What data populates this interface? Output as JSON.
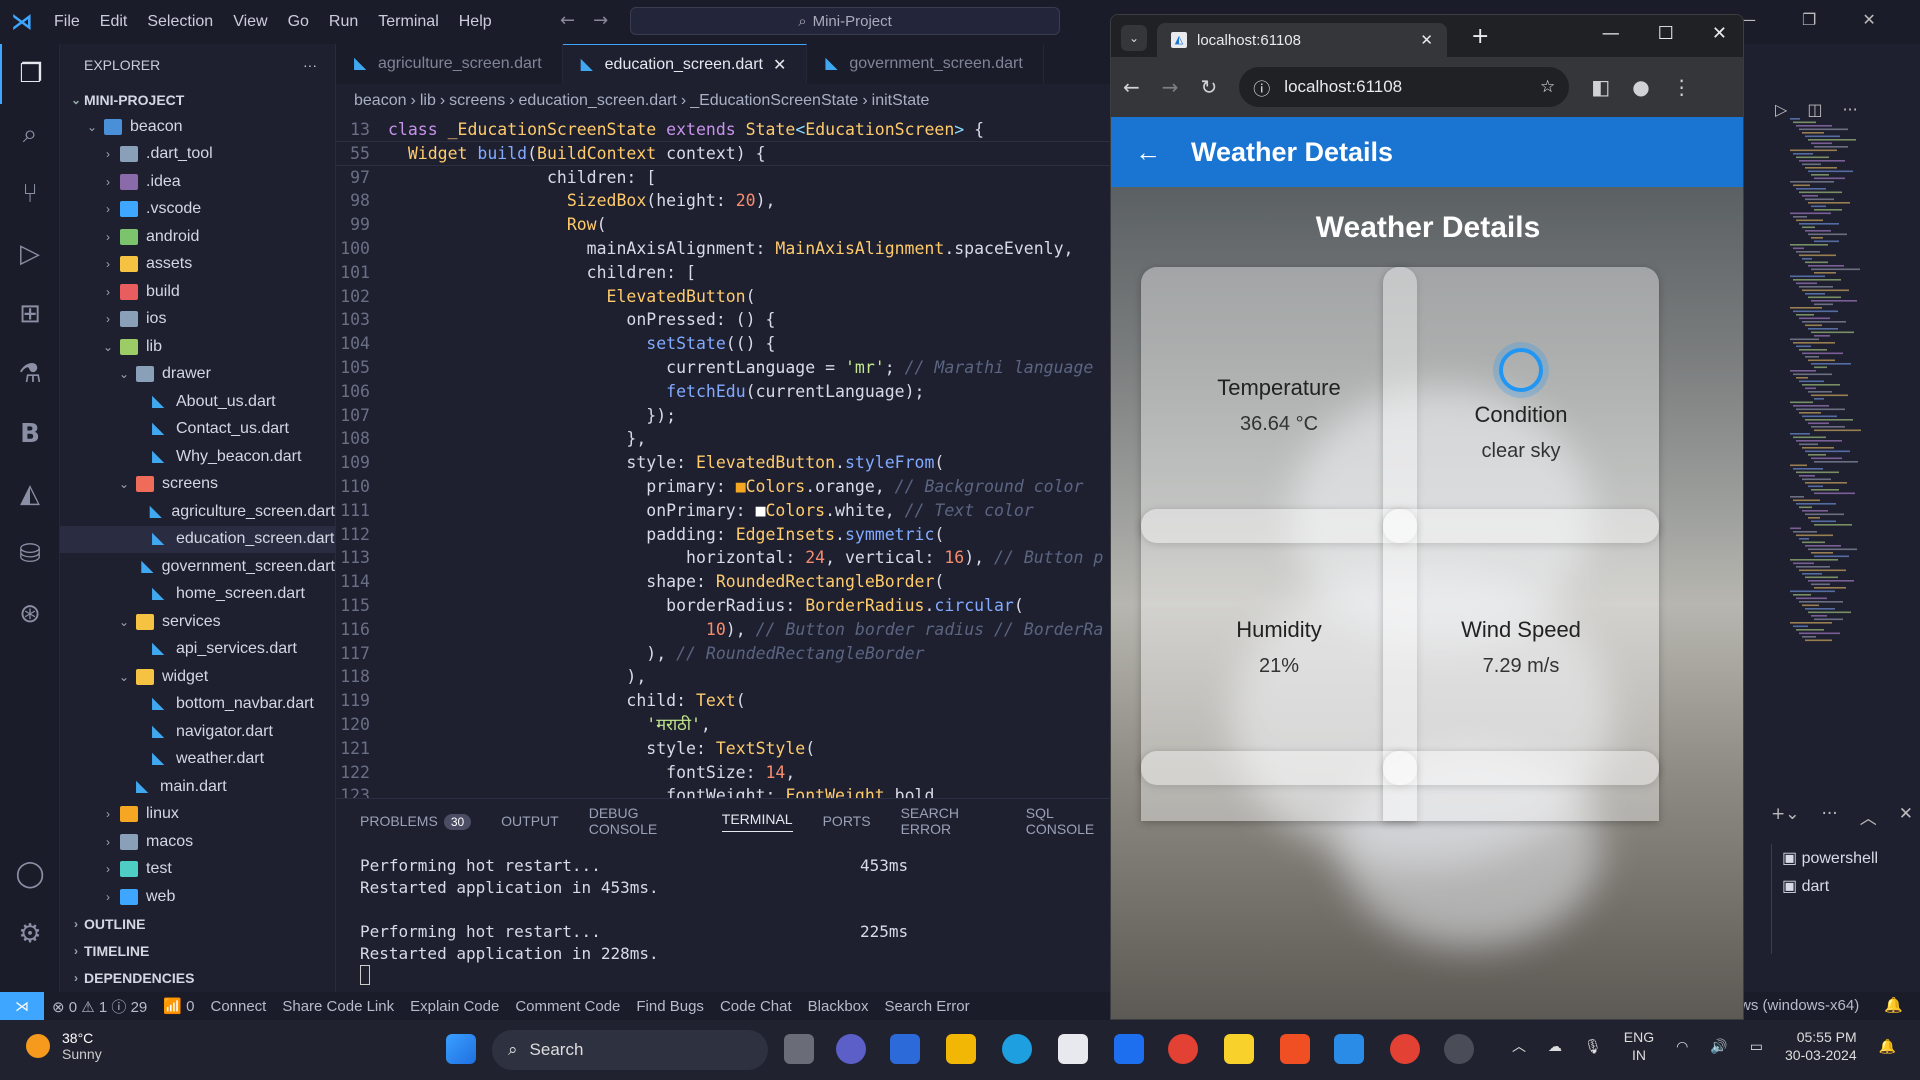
{
  "menu": [
    "File",
    "Edit",
    "Selection",
    "View",
    "Go",
    "Run",
    "Terminal",
    "Help"
  ],
  "command_center": "Mini-Project",
  "explorer": {
    "title": "EXPLORER",
    "project": "MINI-PROJECT",
    "tree": [
      {
        "label": "beacon",
        "depth": 1,
        "type": "folder-open",
        "color": "#4a90d9"
      },
      {
        "label": ".dart_tool",
        "depth": 2,
        "type": "folder",
        "color": "#8aa0b8"
      },
      {
        "label": ".idea",
        "depth": 2,
        "type": "folder",
        "color": "#8a6aa8"
      },
      {
        "label": ".vscode",
        "depth": 2,
        "type": "folder",
        "color": "#3ea6ff"
      },
      {
        "label": "android",
        "depth": 2,
        "type": "folder",
        "color": "#7cc36e"
      },
      {
        "label": "assets",
        "depth": 2,
        "type": "folder",
        "color": "#f5c242"
      },
      {
        "label": "build",
        "depth": 2,
        "type": "folder",
        "color": "#e85d5d"
      },
      {
        "label": "ios",
        "depth": 2,
        "type": "folder",
        "color": "#8aa0b8"
      },
      {
        "label": "lib",
        "depth": 2,
        "type": "folder-open",
        "color": "#9ccc65"
      },
      {
        "label": "drawer",
        "depth": 3,
        "type": "folder-open",
        "color": "#8aa0b8"
      },
      {
        "label": "About_us.dart",
        "depth": 4,
        "type": "dart"
      },
      {
        "label": "Contact_us.dart",
        "depth": 4,
        "type": "dart"
      },
      {
        "label": "Why_beacon.dart",
        "depth": 4,
        "type": "dart"
      },
      {
        "label": "screens",
        "depth": 3,
        "type": "folder-open",
        "color": "#ef6c5a"
      },
      {
        "label": "agriculture_screen.dart",
        "depth": 4,
        "type": "dart"
      },
      {
        "label": "education_screen.dart",
        "depth": 4,
        "type": "dart",
        "selected": true
      },
      {
        "label": "government_screen.dart",
        "depth": 4,
        "type": "dart"
      },
      {
        "label": "home_screen.dart",
        "depth": 4,
        "type": "dart"
      },
      {
        "label": "services",
        "depth": 3,
        "type": "folder-open",
        "color": "#f5c242"
      },
      {
        "label": "api_services.dart",
        "depth": 4,
        "type": "dart"
      },
      {
        "label": "widget",
        "depth": 3,
        "type": "folder-open",
        "color": "#f5c242"
      },
      {
        "label": "bottom_navbar.dart",
        "depth": 4,
        "type": "dart"
      },
      {
        "label": "navigator.dart",
        "depth": 4,
        "type": "dart"
      },
      {
        "label": "weather.dart",
        "depth": 4,
        "type": "dart"
      },
      {
        "label": "main.dart",
        "depth": 3,
        "type": "dart"
      },
      {
        "label": "linux",
        "depth": 2,
        "type": "folder",
        "color": "#f5a623"
      },
      {
        "label": "macos",
        "depth": 2,
        "type": "folder",
        "color": "#8aa0b8"
      },
      {
        "label": "test",
        "depth": 2,
        "type": "folder",
        "color": "#4ecdc4"
      },
      {
        "label": "web",
        "depth": 2,
        "type": "folder",
        "color": "#3ea6ff"
      }
    ],
    "sections": [
      "OUTLINE",
      "TIMELINE",
      "DEPENDENCIES"
    ]
  },
  "tabs": [
    {
      "label": "agriculture_screen.dart",
      "active": false
    },
    {
      "label": "education_screen.dart",
      "active": true
    },
    {
      "label": "government_screen.dart",
      "active": false
    }
  ],
  "breadcrumb": [
    "beacon",
    "lib",
    "screens",
    "education_screen.dart",
    "_EducationScreenState",
    "initState"
  ],
  "code": {
    "sticky": [
      {
        "n": "13",
        "html": "<span class='kw'>class</span> <span class='ty'>_EducationScreenState</span> <span class='kw'>extends</span> <span class='ty'>State</span><span class='pu'>&lt;</span><span class='ty'>EducationScreen</span><span class='pu'>&gt;</span> {"
      },
      {
        "n": "55",
        "html": "  <span class='ty'>Widget</span> <span class='fn'>build</span>(<span class='ty'>BuildContext</span> context) {"
      }
    ],
    "lines": [
      {
        "n": "97",
        "html": "                children: ["
      },
      {
        "n": "98",
        "html": "                  <span class='ty'>SizedBox</span>(height: <span class='num'>20</span>),"
      },
      {
        "n": "99",
        "html": "                  <span class='ty'>Row</span>("
      },
      {
        "n": "100",
        "html": "                    mainAxisAlignment: <span class='ty'>MainAxisAlignment</span>.spaceEvenly,"
      },
      {
        "n": "101",
        "html": "                    children: ["
      },
      {
        "n": "102",
        "html": "                      <span class='ty'>ElevatedButton</span>("
      },
      {
        "n": "103",
        "html": "                        onPressed: () {"
      },
      {
        "n": "104",
        "html": "                          <span class='fn'>setState</span>(() {"
      },
      {
        "n": "105",
        "html": "                            currentLanguage = <span class='str'>'mr'</span>; <span class='cm'>// Marathi language</span>"
      },
      {
        "n": "106",
        "html": "                            <span class='fn'>fetchEdu</span>(currentLanguage);"
      },
      {
        "n": "107",
        "html": "                          });"
      },
      {
        "n": "108",
        "html": "                        },"
      },
      {
        "n": "109",
        "html": "                        style: <span class='ty'>ElevatedButton</span>.<span class='fn'>styleFrom</span>("
      },
      {
        "n": "110",
        "html": "                          primary: <span style='color:#f5a623'>■</span><span class='ty'>Colors</span>.orange, <span class='cm'>// Background color</span>"
      },
      {
        "n": "111",
        "html": "                          onPrimary: <span style='color:#fff'>■</span><span class='ty'>Colors</span>.white, <span class='cm'>// Text color</span>"
      },
      {
        "n": "112",
        "html": "                          padding: <span class='ty'>EdgeInsets</span>.<span class='fn'>symmetric</span>("
      },
      {
        "n": "113",
        "html": "                              horizontal: <span class='num'>24</span>, vertical: <span class='num'>16</span>), <span class='cm'>// Button p</span>"
      },
      {
        "n": "114",
        "html": "                          shape: <span class='ty'>RoundedRectangleBorder</span>("
      },
      {
        "n": "115",
        "html": "                            borderRadius: <span class='ty'>BorderRadius</span>.<span class='fn'>circular</span>("
      },
      {
        "n": "116",
        "html": "                                <span class='num'>10</span>), <span class='cm'>// Button border radius // BorderRa</span>"
      },
      {
        "n": "117",
        "html": "                          ), <span class='cm'>// RoundedRectangleBorder</span>"
      },
      {
        "n": "118",
        "html": "                        ),"
      },
      {
        "n": "119",
        "html": "                        child: <span class='ty'>Text</span>("
      },
      {
        "n": "120",
        "html": "                          <span class='str'>'मराठी'</span>,"
      },
      {
        "n": "121",
        "html": "                          style: <span class='ty'>TextStyle</span>("
      },
      {
        "n": "122",
        "html": "                            fontSize: <span class='num'>14</span>,"
      },
      {
        "n": "123",
        "html": "                            fontWeight: <span class='ty'>FontWeight</span>.bold,"
      }
    ]
  },
  "panel": {
    "tabs": [
      "PROBLEMS",
      "OUTPUT",
      "DEBUG CONSOLE",
      "TERMINAL",
      "PORTS",
      "SEARCH ERROR",
      "SQL CONSOLE"
    ],
    "problems_count": "30",
    "active": "TERMINAL",
    "terminal_lines": [
      {
        "text": "Performing hot restart...",
        "time": "453ms"
      },
      {
        "text": "Restarted application in 453ms.",
        "time": ""
      },
      {
        "text": "",
        "time": ""
      },
      {
        "text": "Performing hot restart...",
        "time": "225ms"
      },
      {
        "text": "Restarted application in 228ms.",
        "time": ""
      }
    ],
    "terminals": [
      "powershell",
      "dart"
    ]
  },
  "statusbar": {
    "errors": "0",
    "warnings": "1",
    "info": "29",
    "ports": "0",
    "items": [
      "Connect",
      "Share Code Link",
      "Explain Code",
      "Comment Code",
      "Find Bugs",
      "Code Chat",
      "Blackbox",
      "Search Error"
    ],
    "right": "ws (windows-x64)"
  },
  "browser": {
    "tab_title": "localhost:61108",
    "url": "localhost:61108",
    "appbar_title": "Weather Details",
    "page_heading": "Weather Details",
    "cards": [
      {
        "label": "Temperature",
        "value": "36.64 °C",
        "icon": ""
      },
      {
        "label": "Condition",
        "value": "clear sky",
        "icon": "sun-icon"
      },
      {
        "label": "Humidity",
        "value": "21%",
        "icon": ""
      },
      {
        "label": "Wind Speed",
        "value": "7.29 m/s",
        "icon": ""
      }
    ]
  },
  "taskbar": {
    "weather_temp": "38°C",
    "weather_desc": "Sunny",
    "search": "Search",
    "lang1": "ENG",
    "lang2": "IN",
    "time": "05:55 PM",
    "date": "30-03-2024"
  }
}
